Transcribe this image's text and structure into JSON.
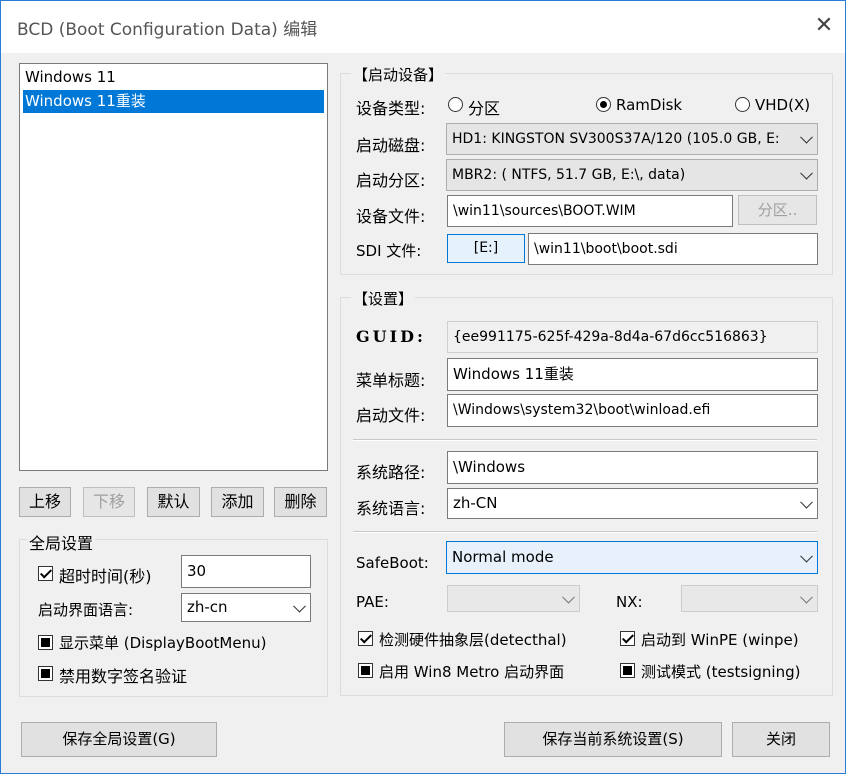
{
  "window": {
    "title": "BCD (Boot Configuration Data) 编辑",
    "close_glyph": "✕"
  },
  "entries": [
    "Windows 11",
    "Windows 11重装"
  ],
  "list_buttons": {
    "up": "上移",
    "down": "下移",
    "default": "默认",
    "add": "添加",
    "delete": "删除"
  },
  "global": {
    "legend": "全局设置",
    "timeout_label": "超时时间(秒)",
    "timeout_value": "30",
    "lang_label": "启动界面语言:",
    "lang_value": "zh-cn",
    "display_menu_label": "显示菜单 (DisplayBootMenu)",
    "disable_sig_label": "禁用数字签名验证"
  },
  "boot_device": {
    "legend": "【启动设备】",
    "type_label": "设备类型:",
    "type_options": [
      "分区",
      "RamDisk",
      "VHD(X)"
    ],
    "disk_label": "启动磁盘:",
    "disk_value": "HD1: KINGSTON SV300S37A/120 (105.0 GB, E:",
    "partition_label": "启动分区:",
    "partition_value": "MBR2: ( NTFS,  51.7 GB, E:\\, data)",
    "file_label": "设备文件:",
    "file_value": "\\win11\\sources\\BOOT.WIM",
    "partition_button": "分区..",
    "sdi_label": "SDI 文件:",
    "sdi_button": "[E:]",
    "sdi_value": "\\win11\\boot\\boot.sdi"
  },
  "settings": {
    "legend": "【设置】",
    "guid_label": "GUID:",
    "guid_value": "{ee991175-625f-429a-8d4a-67d6cc516863}",
    "menu_title_label": "菜单标题:",
    "menu_title_value": "Windows 11重装",
    "boot_file_label": "启动文件:",
    "boot_file_value": "\\Windows\\system32\\boot\\winload.efi",
    "sys_path_label": "系统路径:",
    "sys_path_value": "\\Windows",
    "sys_lang_label": "系统语言:",
    "sys_lang_value": "zh-CN",
    "safeboot_label": "SafeBoot:",
    "safeboot_value": "Normal mode",
    "pae_label": "PAE:",
    "nx_label": "NX:",
    "detecthal_label": "检测硬件抽象层(detecthal)",
    "winpe_label": "启动到 WinPE (winpe)",
    "metro_label": "启用 Win8 Metro 启动界面",
    "testsigning_label": "测试模式 (testsigning)"
  },
  "footer": {
    "save_global": "保存全局设置(G)",
    "save_current": "保存当前系统设置(S)",
    "close": "关闭"
  }
}
